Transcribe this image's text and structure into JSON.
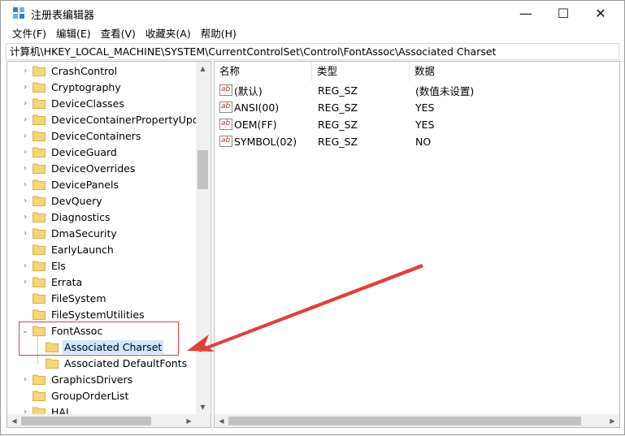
{
  "window": {
    "title": "注册表编辑器",
    "min_glyph": "—",
    "max_glyph": "☐",
    "close_glyph": "✕"
  },
  "menu": [
    "文件(F)",
    "编辑(E)",
    "查看(V)",
    "收藏夹(A)",
    "帮助(H)"
  ],
  "address": "计算机\\HKEY_LOCAL_MACHINE\\SYSTEM\\CurrentControlSet\\Control\\FontAssoc\\Associated Charset",
  "tree": {
    "items": [
      {
        "label": "CrashControl",
        "expander": "›"
      },
      {
        "label": "Cryptography",
        "expander": "›"
      },
      {
        "label": "DeviceClasses",
        "expander": "›"
      },
      {
        "label": "DeviceContainerPropertyUpdat",
        "expander": "›"
      },
      {
        "label": "DeviceContainers",
        "expander": "›"
      },
      {
        "label": "DeviceGuard",
        "expander": "›"
      },
      {
        "label": "DeviceOverrides",
        "expander": "›"
      },
      {
        "label": "DevicePanels",
        "expander": "›"
      },
      {
        "label": "DevQuery",
        "expander": "›"
      },
      {
        "label": "Diagnostics",
        "expander": "›"
      },
      {
        "label": "DmaSecurity",
        "expander": "›"
      },
      {
        "label": "EarlyLaunch",
        "expander": ""
      },
      {
        "label": "Els",
        "expander": "›"
      },
      {
        "label": "Errata",
        "expander": "›"
      },
      {
        "label": "FileSystem",
        "expander": ""
      },
      {
        "label": "FileSystemUtilities",
        "expander": ""
      },
      {
        "label": "FontAssoc",
        "expander": "⌄"
      },
      {
        "label": "Associated Charset",
        "expander": "",
        "child": true,
        "selected": true
      },
      {
        "label": "Associated DefaultFonts",
        "expander": "",
        "child": true
      },
      {
        "label": "GraphicsDrivers",
        "expander": "›"
      },
      {
        "label": "GroupOrderList",
        "expander": ""
      },
      {
        "label": "HAL",
        "expander": "›"
      }
    ]
  },
  "list": {
    "headers": {
      "name": "名称",
      "type": "类型",
      "data": "数据"
    },
    "rows": [
      {
        "name": "(默认)",
        "type": "REG_SZ",
        "data": "(数值未设置)"
      },
      {
        "name": "ANSI(00)",
        "type": "REG_SZ",
        "data": "YES"
      },
      {
        "name": "OEM(FF)",
        "type": "REG_SZ",
        "data": "YES"
      },
      {
        "name": "SYMBOL(02)",
        "type": "REG_SZ",
        "data": "NO"
      }
    ],
    "value_icon_text": "ab"
  },
  "scroll_arrows": {
    "up": "▲",
    "down": "▼",
    "left": "◀",
    "right": "▶"
  },
  "colors": {
    "selection": "#cce8ff",
    "folder": "#f5d57a",
    "annotation": "#e0403a"
  }
}
